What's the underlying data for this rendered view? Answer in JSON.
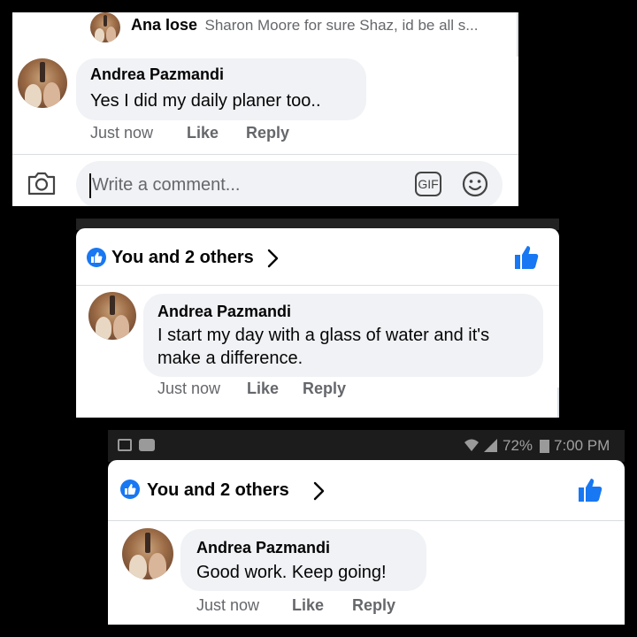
{
  "panel1": {
    "reply_preview": {
      "author": "Ana Iose",
      "text": "Sharon Moore for sure Shaz, id be all s..."
    },
    "comment": {
      "author": "Andrea Pazmandi",
      "text": "Yes I did my daily planer too..",
      "time": "Just now",
      "like_label": "Like",
      "reply_label": "Reply"
    },
    "composer": {
      "placeholder": "Write a comment...",
      "gif_label": "GIF"
    }
  },
  "panel2": {
    "reactions": {
      "label": "You and 2 others"
    },
    "comment": {
      "author": "Andrea Pazmandi",
      "text": "I start my day with a glass of water and it's make a difference.",
      "time": "Just now",
      "like_label": "Like",
      "reply_label": "Reply"
    }
  },
  "panel3": {
    "statusbar": {
      "battery": "72%",
      "time": "7:00 PM"
    },
    "reactions": {
      "label": "You and 2 others"
    },
    "comment": {
      "author": "Andrea Pazmandi",
      "text": "Good work. Keep going!",
      "time": "Just now",
      "like_label": "Like",
      "reply_label": "Reply"
    }
  },
  "colors": {
    "facebook_blue": "#1877f2",
    "bubble_gray": "#f0f2f5",
    "meta_gray": "#65676b"
  }
}
